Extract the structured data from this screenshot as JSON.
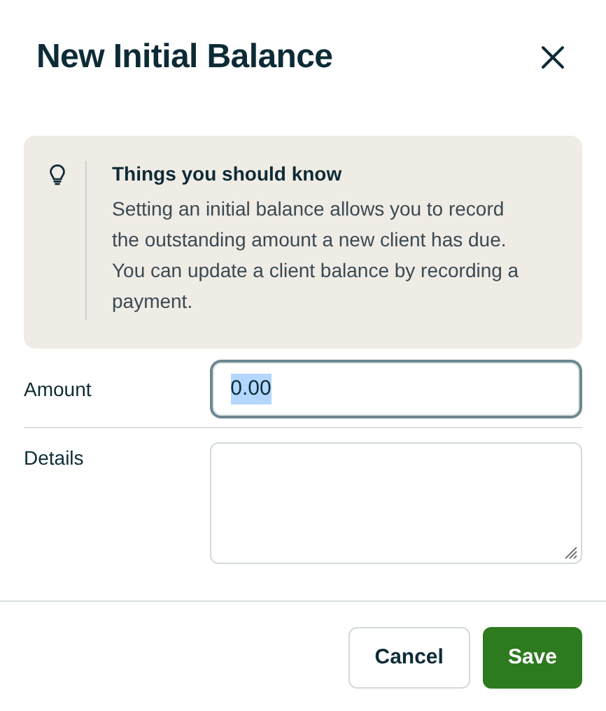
{
  "dialog": {
    "title": "New Initial Balance"
  },
  "notice": {
    "title": "Things you should know",
    "body": "Setting an initial balance allows you to record the outstanding amount a new client has due. You can update a client balance by recording a payment."
  },
  "fields": [
    {
      "kind": "input",
      "label": "Amount",
      "value": "0.00",
      "focused": true,
      "text_selected": true
    },
    {
      "kind": "textarea",
      "label": "Details",
      "focused": false
    }
  ],
  "buttons": [
    {
      "label": "Cancel",
      "kind": "secondary"
    },
    {
      "label": "Save",
      "kind": "primary"
    }
  ]
}
